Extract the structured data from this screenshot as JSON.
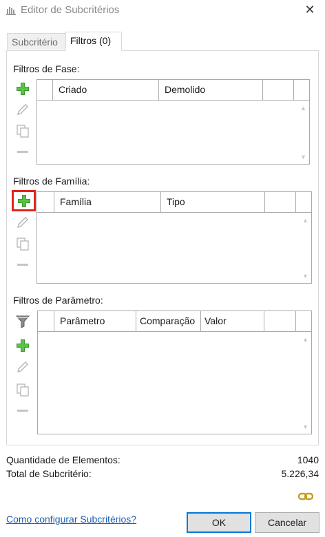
{
  "window": {
    "title": "Editor de Subcritérios",
    "app_icon": "revit-app-icon",
    "close_glyph": "✕"
  },
  "tabs": [
    {
      "label": "Subcritério",
      "active": false
    },
    {
      "label": "Filtros (0)",
      "active": true
    }
  ],
  "phase_filters": {
    "label": "Filtros de Fase:",
    "columns": [
      "",
      "Criado",
      "Demolido",
      ""
    ],
    "rows": []
  },
  "family_filters": {
    "label": "Filtros de Família:",
    "columns": [
      "",
      "Família",
      "Tipo",
      ""
    ],
    "rows": [],
    "add_button_highlighted": true
  },
  "parameter_filters": {
    "label": "Filtros de Parâmetro:",
    "columns": [
      "",
      "Parâmetro",
      "Comparação",
      "Valor",
      ""
    ],
    "rows": []
  },
  "tool_icons": [
    "add-icon",
    "edit-icon",
    "copy-icon",
    "remove-icon",
    "filter-icon"
  ],
  "summary": {
    "element_count_label": "Quantidade de Elementos:",
    "element_count_value": "1040",
    "total_label": "Total de Subcritério:",
    "total_value": "5.226,34"
  },
  "footer": {
    "help_link": "Como configurar Subcritérios?",
    "ok_label": "OK",
    "cancel_label": "Cancelar"
  },
  "colors": {
    "accent": "#0078d7",
    "link": "#1a5fb4",
    "add_green": "#3a9a2a",
    "highlight_red": "#e1251b"
  }
}
